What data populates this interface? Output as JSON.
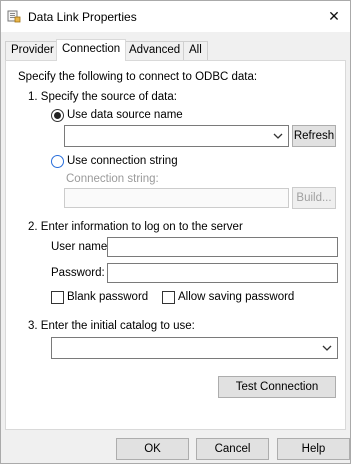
{
  "window": {
    "title": "Data Link Properties",
    "close_glyph": "✕"
  },
  "tabs": [
    {
      "label": "Provider"
    },
    {
      "label": "Connection"
    },
    {
      "label": "Advanced"
    },
    {
      "label": "All"
    }
  ],
  "connection": {
    "intro": "Specify the following to connect to ODBC data:",
    "step1": "1. Specify the source of data:",
    "use_dsn": "Use data source name",
    "dsn_value": "",
    "refresh": "Refresh",
    "use_conn_string": "Use connection string",
    "conn_string_label": "Connection string:",
    "conn_string_value": "",
    "build": "Build...",
    "step2": "2. Enter information to log on to the server",
    "user_name_label": "User name:",
    "user_name_value": "",
    "password_label": "Password:",
    "password_value": "",
    "blank_password": "Blank password",
    "allow_saving": "Allow saving password",
    "step3": "3. Enter the initial catalog to use:",
    "catalog_value": "",
    "test_connection": "Test Connection"
  },
  "footer": {
    "ok": "OK",
    "cancel": "Cancel",
    "help": "Help"
  }
}
